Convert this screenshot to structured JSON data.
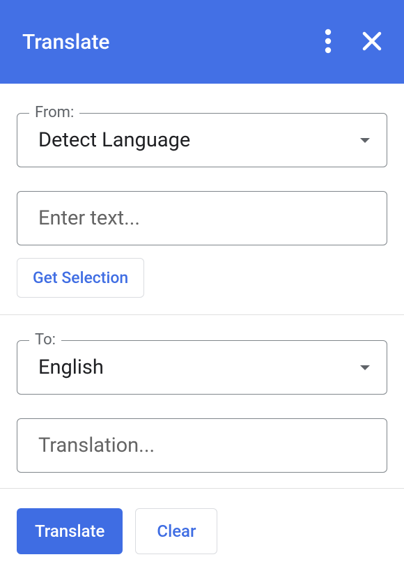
{
  "header": {
    "title": "Translate"
  },
  "from": {
    "label": "From:",
    "selected": "Detect Language"
  },
  "input": {
    "placeholder": "Enter text..."
  },
  "getSelection": {
    "label": "Get Selection"
  },
  "to": {
    "label": "To:",
    "selected": "English"
  },
  "output": {
    "placeholder": "Translation..."
  },
  "actions": {
    "translate": "Translate",
    "clear": "Clear"
  }
}
